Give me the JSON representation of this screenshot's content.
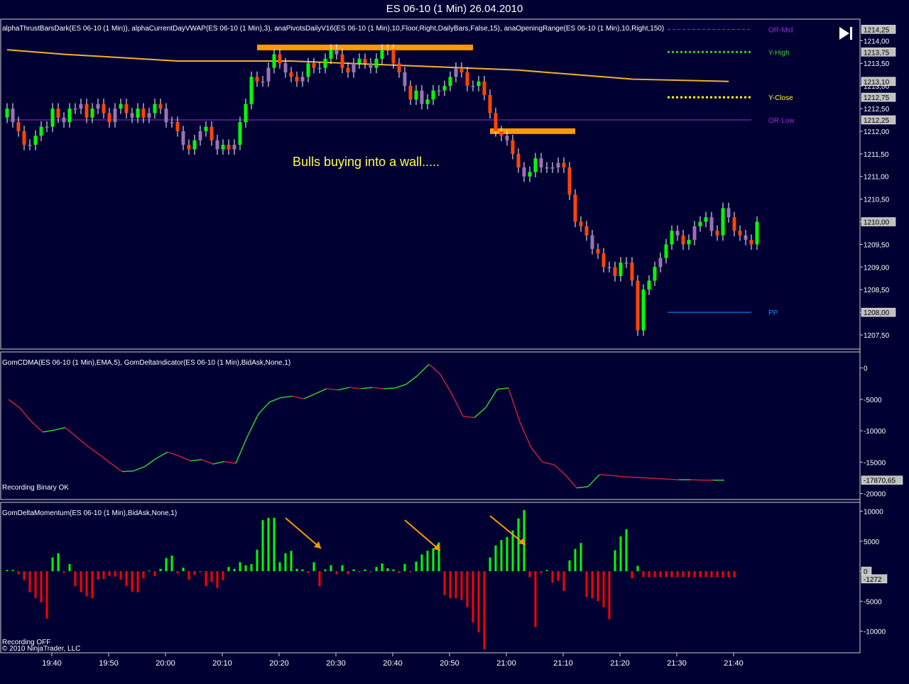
{
  "window": {
    "title": "ES 06-10 (1 Min)  26.04.2010"
  },
  "panels": {
    "price": {
      "indicator_line": "alphaThrustBarsDark(ES 06-10 (1 Min)), alphaCurrentDayVWAP(ES 06-10 (1 Min),3),  anaPivotsDailyV16(ES 06-10 (1 Min),10,Floor,Right,DailyBars,False,15), anaOpeningRange(ES 06-10 (1 Min),10,Right,150)",
      "annotation": "Bulls buying into a wall.....",
      "tick_labels": [
        "1214,00",
        "1213,50",
        "1213,00",
        "1212,50",
        "1212,00",
        "1211,50",
        "1211,00",
        "1210,50",
        "1210,00",
        "1209,50",
        "1209,00",
        "1208,50",
        "1208,00",
        "1207,50"
      ],
      "price_tags": [
        {
          "text": "1214,25",
          "fill": "#c0c0c0",
          "value": 1214.25
        },
        {
          "text": "1213,75",
          "fill": "#c0c0c0",
          "value": 1213.75
        },
        {
          "text": "1213,10",
          "fill": "#c0c0c0",
          "value": 1213.1
        },
        {
          "text": "1212,75",
          "fill": "#c0c0c0",
          "value": 1212.75
        },
        {
          "text": "1212,25",
          "fill": "#c0c0c0",
          "value": 1212.25
        },
        {
          "text": "1210,00",
          "fill": "#c0c0c0",
          "value": 1210.0
        },
        {
          "text": "1208,00",
          "fill": "#c0c0c0",
          "value": 1208.0
        }
      ],
      "levels": [
        {
          "label": "OR-Mid",
          "color": "#9932cc",
          "value": 1214.25,
          "style": "dash"
        },
        {
          "label": "Y-High",
          "color": "#32cd32",
          "value": 1213.75,
          "style": "dot"
        },
        {
          "label": "Y-Close",
          "color": "#ffff00",
          "value": 1212.75,
          "style": "dot"
        },
        {
          "label": "OR-Low",
          "color": "#9932cc",
          "value": 1212.25,
          "style": "solid"
        },
        {
          "label": "PP",
          "color": "#1e90ff",
          "value": 1208.0,
          "style": "solid"
        }
      ]
    },
    "cdma": {
      "indicator_line": "GomCDMA(ES 06-10 (1 Min),EMA,5), GomDeltaIndicator(ES 06-10 (1 Min),BidAsk,None,1)",
      "status": "Recording Binary OK",
      "tick_labels": [
        "0",
        "-5000",
        "-10000",
        "-15000",
        "-20000"
      ],
      "value_tag": "-17870,65"
    },
    "momentum": {
      "indicator_line": "GomDeltaMomentum(ES 06-10 (1 Min),BidAsk,None,1)",
      "status": "Recording OFF",
      "copyright": "© 2010 NinjaTrader, LLC",
      "tick_labels": [
        "10000",
        "5000",
        "0",
        "-5000",
        "-10000"
      ],
      "value_tag_zero": "0",
      "value_tag": "-1272"
    }
  },
  "time_axis": [
    "19:40",
    "19:50",
    "20:00",
    "20:10",
    "20:20",
    "20:30",
    "20:40",
    "20:50",
    "21:00",
    "21:10",
    "21:20",
    "21:30",
    "21:40"
  ],
  "colors": {
    "background": "#000033",
    "bull": "#00ff00",
    "bear": "#ff4500",
    "neutral": "#9b72b0",
    "vwap": "#f0b428",
    "highlight": "#ff9900",
    "delta_pos": "#00ff00",
    "delta_neg": "#ff0000"
  },
  "chart_data": [
    {
      "type": "candlestick",
      "panel": "price",
      "ylim": [
        1207.25,
        1214.35
      ],
      "x_start": "19:35",
      "x_end": "21:42",
      "vwap": [
        [
          0,
          1213.8
        ],
        [
          10,
          1213.7
        ],
        [
          30,
          1213.55
        ],
        [
          50,
          1213.55
        ],
        [
          70,
          1213.45
        ],
        [
          90,
          1213.35
        ],
        [
          100,
          1213.25
        ],
        [
          110,
          1213.15
        ],
        [
          127,
          1213.1
        ]
      ],
      "highlight_lines": [
        [
          1213.85,
          44,
          82
        ],
        [
          1212.0,
          85,
          100
        ]
      ],
      "closes": [
        1212.5,
        1212.2,
        1212.0,
        1211.7,
        1211.7,
        1211.9,
        1212.1,
        1212.1,
        1212.5,
        1212.3,
        1212.2,
        1212.5,
        1212.5,
        1212.6,
        1212.3,
        1212.5,
        1212.6,
        1212.4,
        1212.2,
        1212.5,
        1212.6,
        1212.4,
        1212.3,
        1212.5,
        1212.3,
        1212.4,
        1212.6,
        1212.5,
        1212.2,
        1212.2,
        1212.0,
        1211.7,
        1211.6,
        1211.8,
        1212.0,
        1212.1,
        1211.8,
        1211.6,
        1211.7,
        1211.6,
        1211.7,
        1212.2,
        1212.6,
        1213.2,
        1213.1,
        1213.1,
        1213.4,
        1213.7,
        1213.5,
        1213.3,
        1213.2,
        1213.1,
        1213.2,
        1213.5,
        1213.4,
        1213.4,
        1213.6,
        1213.8,
        1213.7,
        1213.4,
        1213.3,
        1213.5,
        1213.6,
        1213.5,
        1213.4,
        1213.6,
        1213.8,
        1213.8,
        1213.5,
        1213.3,
        1213.0,
        1212.7,
        1212.9,
        1212.6,
        1212.7,
        1212.9,
        1212.9,
        1213.0,
        1213.2,
        1213.4,
        1213.3,
        1213.0,
        1213.0,
        1213.1,
        1212.8,
        1212.4,
        1212.0,
        1211.9,
        1211.8,
        1211.5,
        1211.2,
        1211.0,
        1211.1,
        1211.4,
        1211.2,
        1211.2,
        1211.2,
        1211.3,
        1211.2,
        1210.6,
        1210.0,
        1209.9,
        1209.7,
        1209.4,
        1209.3,
        1209.0,
        1209.0,
        1208.8,
        1209.1,
        1209.1,
        1208.7,
        1207.6,
        1208.5,
        1208.7,
        1209.0,
        1209.2,
        1209.5,
        1209.8,
        1209.7,
        1209.5,
        1209.6,
        1209.9,
        1210.0,
        1210.1,
        1209.8,
        1209.7,
        1210.3,
        1210.1,
        1209.8,
        1209.7,
        1209.6,
        1209.5,
        1210.0
      ]
    },
    {
      "type": "line",
      "panel": "cdma",
      "ylim": [
        -20500,
        1200
      ],
      "x": [
        0,
        2,
        4,
        6,
        8,
        10,
        12,
        14,
        16,
        18,
        20,
        22,
        24,
        26,
        28,
        30,
        32,
        34,
        36,
        38,
        40,
        42,
        44,
        46,
        48,
        50,
        52,
        54,
        56,
        58,
        60,
        62,
        64,
        66,
        68,
        70,
        72,
        74,
        76,
        78,
        80,
        82,
        84,
        86,
        88,
        90,
        92,
        94,
        96,
        98,
        100,
        102,
        104,
        106,
        108,
        110,
        112,
        114,
        116,
        118,
        120,
        122,
        124,
        126
      ],
      "values": [
        -5000,
        -6400,
        -8500,
        -10200,
        -9900,
        -9500,
        -11000,
        -12500,
        -13800,
        -15200,
        -16500,
        -16400,
        -15700,
        -14400,
        -13400,
        -14000,
        -14800,
        -14600,
        -15300,
        -14900,
        -15200,
        -11000,
        -7300,
        -5400,
        -4700,
        -4500,
        -4900,
        -4100,
        -3300,
        -3500,
        -3100,
        -3300,
        -3100,
        -3300,
        -3200,
        -2600,
        -1200,
        600,
        -1000,
        -4100,
        -7700,
        -7900,
        -6300,
        -3400,
        -3200,
        -8600,
        -12700,
        -15000,
        -15400,
        -17000,
        -19100,
        -18900,
        -17000,
        -17100,
        -17300,
        -17400,
        -17500,
        -17600,
        -17700,
        -17800,
        -17800,
        -17860,
        -17870,
        -17870
      ]
    },
    {
      "type": "bar",
      "panel": "momentum",
      "ylim": [
        -13000,
        11000
      ],
      "x_start": "19:35",
      "values": [
        200,
        200,
        -500,
        -1500,
        -3500,
        -4500,
        -5200,
        -7900,
        2300,
        3000,
        -300,
        1200,
        -2500,
        -3500,
        -4200,
        -4500,
        -1400,
        -1300,
        -800,
        -900,
        -1400,
        -2500,
        -3400,
        -3500,
        -1200,
        100,
        -800,
        400,
        2200,
        2600,
        -400,
        600,
        -1400,
        -600,
        -200,
        -2500,
        -1800,
        -2800,
        -1500,
        700,
        400,
        1500,
        1000,
        1200,
        3600,
        8500,
        8900,
        8900,
        1500,
        3000,
        3400,
        400,
        300,
        -300,
        1500,
        -2500,
        300,
        1000,
        -500,
        1000,
        -500,
        300,
        -200,
        300,
        -200,
        700,
        1300,
        500,
        300,
        -300,
        1200,
        -200,
        1600,
        2800,
        3400,
        3800,
        4800,
        -4000,
        -4500,
        -4500,
        -4800,
        -6000,
        -8500,
        -10200,
        -13000,
        2300,
        4300,
        5200,
        5700,
        6800,
        8800,
        10200,
        -1000,
        -9300,
        -300,
        200,
        -1900,
        -1600,
        -3300,
        1800,
        3700,
        4700,
        -4300,
        -4500,
        -5000,
        -6000,
        -8000,
        3500,
        5800,
        7000,
        -1200,
        900,
        -1000,
        -1000,
        -1000,
        -1000,
        -1000,
        -1000,
        -1000,
        -1000,
        -1000,
        -1000,
        -1000,
        -1000,
        -1000,
        -1000,
        -1000,
        -1000,
        -1000
      ]
    }
  ]
}
